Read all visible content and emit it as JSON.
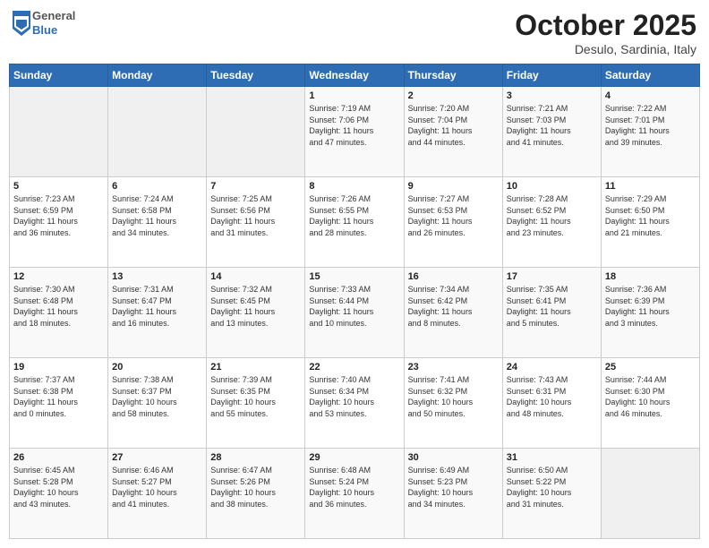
{
  "header": {
    "logo_general": "General",
    "logo_blue": "Blue",
    "month_title": "October 2025",
    "subtitle": "Desulo, Sardinia, Italy"
  },
  "days_of_week": [
    "Sunday",
    "Monday",
    "Tuesday",
    "Wednesday",
    "Thursday",
    "Friday",
    "Saturday"
  ],
  "weeks": [
    [
      {
        "day": "",
        "info": ""
      },
      {
        "day": "",
        "info": ""
      },
      {
        "day": "",
        "info": ""
      },
      {
        "day": "1",
        "info": "Sunrise: 7:19 AM\nSunset: 7:06 PM\nDaylight: 11 hours\nand 47 minutes."
      },
      {
        "day": "2",
        "info": "Sunrise: 7:20 AM\nSunset: 7:04 PM\nDaylight: 11 hours\nand 44 minutes."
      },
      {
        "day": "3",
        "info": "Sunrise: 7:21 AM\nSunset: 7:03 PM\nDaylight: 11 hours\nand 41 minutes."
      },
      {
        "day": "4",
        "info": "Sunrise: 7:22 AM\nSunset: 7:01 PM\nDaylight: 11 hours\nand 39 minutes."
      }
    ],
    [
      {
        "day": "5",
        "info": "Sunrise: 7:23 AM\nSunset: 6:59 PM\nDaylight: 11 hours\nand 36 minutes."
      },
      {
        "day": "6",
        "info": "Sunrise: 7:24 AM\nSunset: 6:58 PM\nDaylight: 11 hours\nand 34 minutes."
      },
      {
        "day": "7",
        "info": "Sunrise: 7:25 AM\nSunset: 6:56 PM\nDaylight: 11 hours\nand 31 minutes."
      },
      {
        "day": "8",
        "info": "Sunrise: 7:26 AM\nSunset: 6:55 PM\nDaylight: 11 hours\nand 28 minutes."
      },
      {
        "day": "9",
        "info": "Sunrise: 7:27 AM\nSunset: 6:53 PM\nDaylight: 11 hours\nand 26 minutes."
      },
      {
        "day": "10",
        "info": "Sunrise: 7:28 AM\nSunset: 6:52 PM\nDaylight: 11 hours\nand 23 minutes."
      },
      {
        "day": "11",
        "info": "Sunrise: 7:29 AM\nSunset: 6:50 PM\nDaylight: 11 hours\nand 21 minutes."
      }
    ],
    [
      {
        "day": "12",
        "info": "Sunrise: 7:30 AM\nSunset: 6:48 PM\nDaylight: 11 hours\nand 18 minutes."
      },
      {
        "day": "13",
        "info": "Sunrise: 7:31 AM\nSunset: 6:47 PM\nDaylight: 11 hours\nand 16 minutes."
      },
      {
        "day": "14",
        "info": "Sunrise: 7:32 AM\nSunset: 6:45 PM\nDaylight: 11 hours\nand 13 minutes."
      },
      {
        "day": "15",
        "info": "Sunrise: 7:33 AM\nSunset: 6:44 PM\nDaylight: 11 hours\nand 10 minutes."
      },
      {
        "day": "16",
        "info": "Sunrise: 7:34 AM\nSunset: 6:42 PM\nDaylight: 11 hours\nand 8 minutes."
      },
      {
        "day": "17",
        "info": "Sunrise: 7:35 AM\nSunset: 6:41 PM\nDaylight: 11 hours\nand 5 minutes."
      },
      {
        "day": "18",
        "info": "Sunrise: 7:36 AM\nSunset: 6:39 PM\nDaylight: 11 hours\nand 3 minutes."
      }
    ],
    [
      {
        "day": "19",
        "info": "Sunrise: 7:37 AM\nSunset: 6:38 PM\nDaylight: 11 hours\nand 0 minutes."
      },
      {
        "day": "20",
        "info": "Sunrise: 7:38 AM\nSunset: 6:37 PM\nDaylight: 10 hours\nand 58 minutes."
      },
      {
        "day": "21",
        "info": "Sunrise: 7:39 AM\nSunset: 6:35 PM\nDaylight: 10 hours\nand 55 minutes."
      },
      {
        "day": "22",
        "info": "Sunrise: 7:40 AM\nSunset: 6:34 PM\nDaylight: 10 hours\nand 53 minutes."
      },
      {
        "day": "23",
        "info": "Sunrise: 7:41 AM\nSunset: 6:32 PM\nDaylight: 10 hours\nand 50 minutes."
      },
      {
        "day": "24",
        "info": "Sunrise: 7:43 AM\nSunset: 6:31 PM\nDaylight: 10 hours\nand 48 minutes."
      },
      {
        "day": "25",
        "info": "Sunrise: 7:44 AM\nSunset: 6:30 PM\nDaylight: 10 hours\nand 46 minutes."
      }
    ],
    [
      {
        "day": "26",
        "info": "Sunrise: 6:45 AM\nSunset: 5:28 PM\nDaylight: 10 hours\nand 43 minutes."
      },
      {
        "day": "27",
        "info": "Sunrise: 6:46 AM\nSunset: 5:27 PM\nDaylight: 10 hours\nand 41 minutes."
      },
      {
        "day": "28",
        "info": "Sunrise: 6:47 AM\nSunset: 5:26 PM\nDaylight: 10 hours\nand 38 minutes."
      },
      {
        "day": "29",
        "info": "Sunrise: 6:48 AM\nSunset: 5:24 PM\nDaylight: 10 hours\nand 36 minutes."
      },
      {
        "day": "30",
        "info": "Sunrise: 6:49 AM\nSunset: 5:23 PM\nDaylight: 10 hours\nand 34 minutes."
      },
      {
        "day": "31",
        "info": "Sunrise: 6:50 AM\nSunset: 5:22 PM\nDaylight: 10 hours\nand 31 minutes."
      },
      {
        "day": "",
        "info": ""
      }
    ]
  ]
}
